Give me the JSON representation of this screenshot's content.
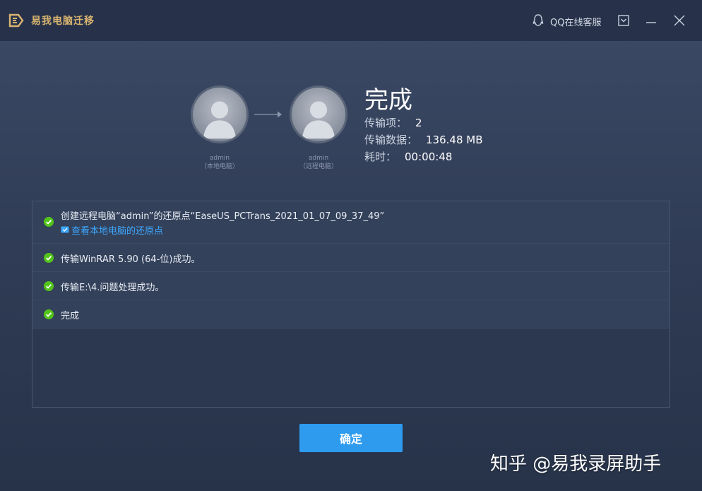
{
  "window": {
    "app_title": "易我电脑迁移",
    "qq_service": "QQ在线客服",
    "icons": {
      "logo": "easeus-logo-icon",
      "qq": "qq-penguin-icon",
      "download": "download-icon",
      "minimize": "minimize-icon",
      "close": "close-icon"
    }
  },
  "transfer": {
    "source": {
      "name": "admin",
      "role": "（本地电脑）"
    },
    "target": {
      "name": "admin",
      "role": "（远程电脑）"
    },
    "status_title": "完成",
    "items_label": "传输项：",
    "items_value": "2",
    "data_label": "传输数据：",
    "data_value": "136.48 MB",
    "time_label": "耗时：",
    "time_value": "00:00:48"
  },
  "log": [
    {
      "text": "创建远程电脑“admin”的还原点“EaseUS_PCTrans_2021_01_07_09_37_49”",
      "link": "查看本地电脑的还原点"
    },
    {
      "text": "传输WinRAR 5.90 (64-位)成功。"
    },
    {
      "text": "传输E:\\4.问题处理成功。"
    },
    {
      "text": "完成"
    }
  ],
  "confirm_button": "确定",
  "watermark": "知乎 @易我录屏助手",
  "colors": {
    "accent": "#2e9bef",
    "success": "#52c41a",
    "link": "#3da8ff",
    "brand_gold": "#d8b470"
  }
}
